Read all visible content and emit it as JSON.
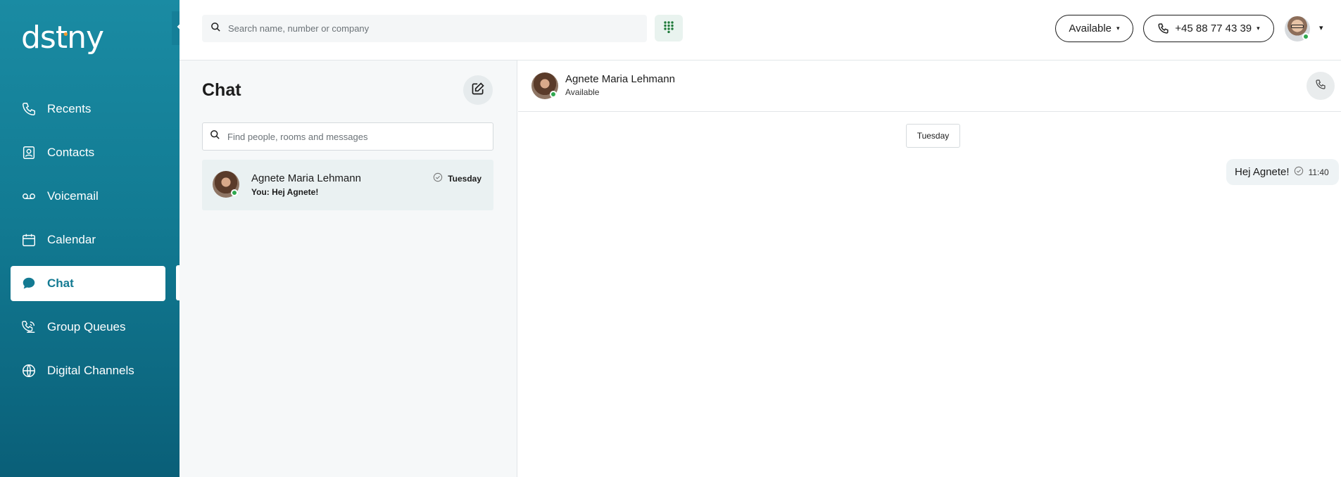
{
  "app": {
    "logo_text_a": "ds",
    "logo_text_b": "t",
    "logo_text_c": "ny",
    "brand_gradient": [
      "#1a8ba3",
      "#0a5f78"
    ],
    "accent_orange": "#f29a2e",
    "online_color": "#2fa84f"
  },
  "sidebar": {
    "items": [
      {
        "label": "Recents",
        "icon": "phone-icon",
        "active": false
      },
      {
        "label": "Contacts",
        "icon": "contact-card-icon",
        "active": false
      },
      {
        "label": "Voicemail",
        "icon": "voicemail-icon",
        "active": false
      },
      {
        "label": "Calendar",
        "icon": "calendar-icon",
        "active": false
      },
      {
        "label": "Chat",
        "icon": "chat-bubble-icon",
        "active": true
      },
      {
        "label": "Group Queues",
        "icon": "group-queue-icon",
        "active": false
      },
      {
        "label": "Digital Channels",
        "icon": "globe-icon",
        "active": false
      }
    ]
  },
  "topbar": {
    "search_placeholder": "Search name, number or company",
    "status_label": "Available",
    "phone_number": "+45 88 77 43 39",
    "caret": "▾"
  },
  "chat_list": {
    "title": "Chat",
    "search_placeholder": "Find people, rooms and messages",
    "conversations": [
      {
        "name": "Agnete Maria Lehmann",
        "preview": "You: Hej Agnete!",
        "date": "Tuesday",
        "online": true
      }
    ]
  },
  "conversation": {
    "contact_name": "Agnete Maria Lehmann",
    "contact_status": "Available",
    "date_divider": "Tuesday",
    "messages": [
      {
        "text": "Hej Agnete!",
        "time": "11:40",
        "from_me": true
      }
    ]
  }
}
